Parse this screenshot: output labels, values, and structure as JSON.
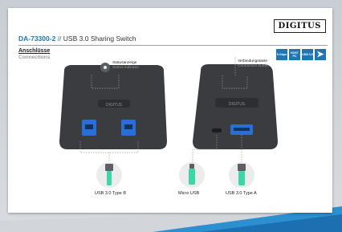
{
  "header": {
    "logo": "DIGITUS",
    "model": "DA-73300-2",
    "separator": "//",
    "product": "USB 3.0 Sharing Switch"
  },
  "section": {
    "title_de": "Anschlüsse",
    "title_en": "Connections"
  },
  "badges": [
    {
      "label": "5 Gbps",
      "icon": "speed-icon"
    },
    {
      "label": "HOST PC",
      "icon": "host-pc-icon"
    },
    {
      "label": "USB 3.0",
      "icon": "usb-icon"
    },
    {
      "label": "",
      "icon": "play-arrow-icon"
    }
  ],
  "callouts": {
    "status_de": "Statusanzeige",
    "status_en": "Status indicator",
    "button_de": "Verbindungstaste",
    "button_en": "Connection button"
  },
  "device": {
    "brand_label": "DIGITUS"
  },
  "connectors": {
    "usb_b": "USB 3.0 Type B",
    "micro_usb": "Micro USB",
    "usb_a": "USB 3.0 Type A"
  },
  "colors": {
    "accent": "#1e76b5",
    "device": "#3a3c3f",
    "port_blue": "#2a6fd6",
    "circle": "#ececec"
  }
}
